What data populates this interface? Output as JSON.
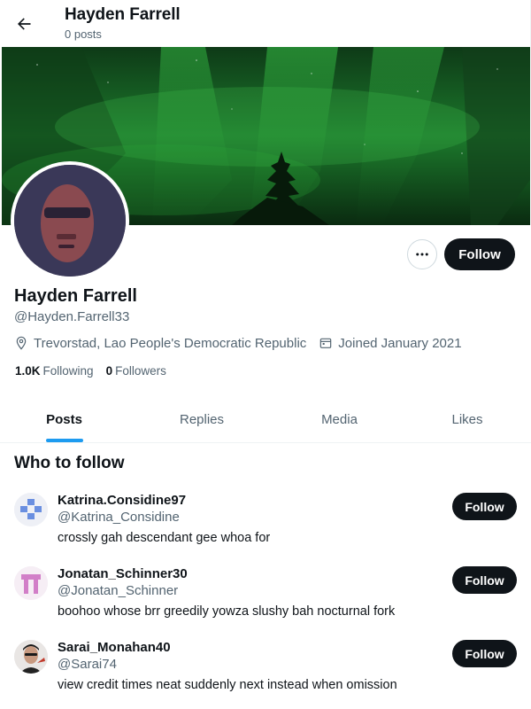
{
  "header": {
    "title": "Hayden Farrell",
    "subtitle": "0 posts"
  },
  "profile": {
    "name": "Hayden Farrell",
    "handle": "@Hayden.Farrell33",
    "location": "Trevorstad, Lao People's Democratic Republic",
    "joined": "Joined January 2021",
    "following_count": "1.0K",
    "following_label": "Following",
    "followers_count": "0",
    "followers_label": "Followers",
    "follow_label": "Follow"
  },
  "tabs": [
    {
      "label": "Posts",
      "active": true
    },
    {
      "label": "Replies",
      "active": false
    },
    {
      "label": "Media",
      "active": false
    },
    {
      "label": "Likes",
      "active": false
    }
  ],
  "who_to_follow": {
    "title": "Who to follow",
    "items": [
      {
        "name": "Katrina.Considine97",
        "handle": "@Katrina_Considine",
        "bio": "crossly gah descendant gee whoa for",
        "follow_label": "Follow"
      },
      {
        "name": "Jonatan_Schinner30",
        "handle": "@Jonatan_Schinner",
        "bio": "boohoo whose brr greedily yowza slushy bah nocturnal fork",
        "follow_label": "Follow"
      },
      {
        "name": "Sarai_Monahan40",
        "handle": "@Sarai74",
        "bio": "view credit times neat suddenly next instead when omission",
        "follow_label": "Follow"
      }
    ]
  },
  "icons": {
    "back": "arrow-left-icon",
    "more": "more-horizontal-icon",
    "location": "location-pin-icon",
    "calendar": "calendar-icon"
  },
  "colors": {
    "accent": "#1d9bf0",
    "button_dark": "#0f1419",
    "secondary_text": "#536471"
  }
}
